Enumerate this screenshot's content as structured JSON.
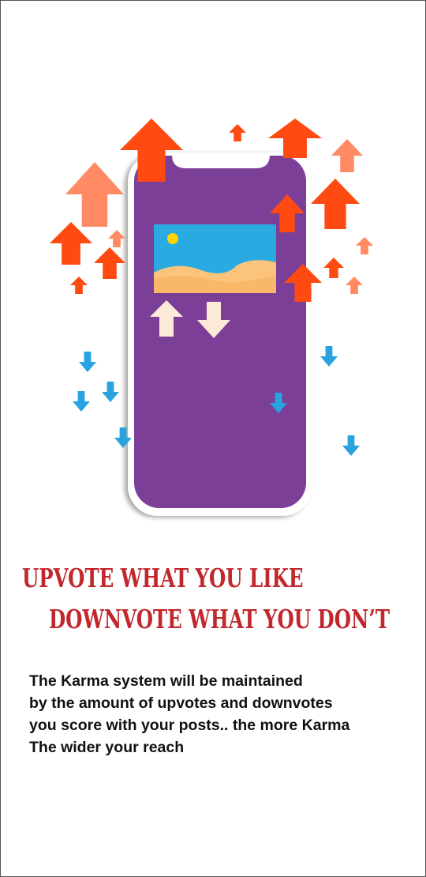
{
  "headline": {
    "line1": "UPVOTE WHAT YOU LIKE",
    "line2": "DOWNVOTE WHAT YOU DON’T"
  },
  "description": {
    "lines": [
      "The Karma system will be maintained",
      "by the amount of upvotes and downvotes",
      "you score with your posts.. the more Karma",
      "The wider your reach"
    ]
  },
  "colors": {
    "phone_screen": "#7b3f98",
    "phone_body": "#ffffff",
    "upvote_red": "#ff4a12",
    "upvote_salmon": "#ff8a63",
    "downvote_blue": "#29a3e0",
    "vote_button": "#fde9d7",
    "sky": "#29abe2",
    "sand": "#fbc47a",
    "sun": "#ffd400",
    "headline": "#c1272d"
  },
  "icons": {
    "upvote": "arrow-up-icon",
    "downvote": "arrow-down-icon",
    "image": "image-icon"
  }
}
